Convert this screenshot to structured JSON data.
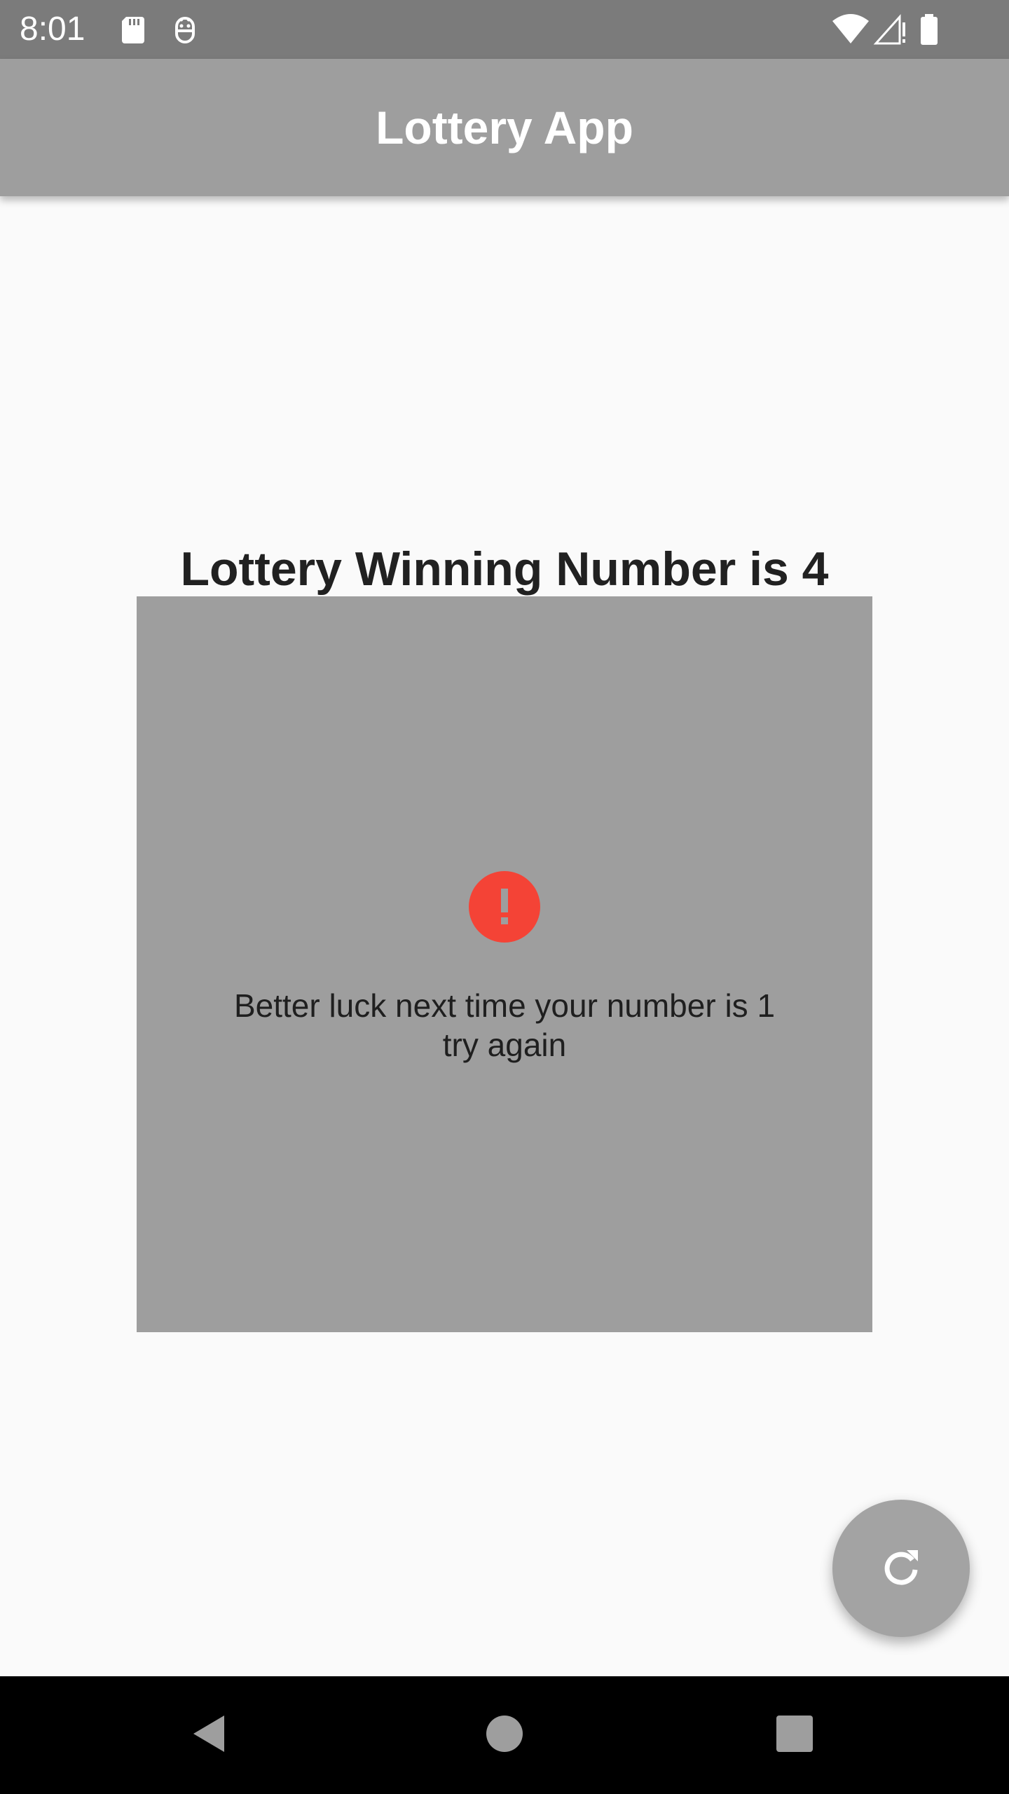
{
  "status_bar": {
    "time": "8:01",
    "left_icons": [
      "sd-card-icon",
      "debug-robot-icon"
    ],
    "right_icons": [
      "wifi-icon",
      "cell-signal-icon",
      "battery-icon"
    ]
  },
  "app_bar": {
    "title": "Lottery App"
  },
  "main": {
    "heading": "Lottery Winning Number is 4",
    "result_card": {
      "icon": "error-circle-icon",
      "message": "Better luck next time your number is 1\ntry again"
    }
  },
  "fab": {
    "icon": "refresh-icon"
  },
  "nav_bar": {
    "icons": [
      "back-icon",
      "home-icon",
      "recents-icon"
    ]
  },
  "colors": {
    "status_bar": "#7b7b7b",
    "app_bar": "#9e9e9e",
    "background": "#fafafa",
    "card": "#9e9e9e",
    "error": "#f44336",
    "fab": "#a3a3a3",
    "nav_bar": "#000000"
  }
}
